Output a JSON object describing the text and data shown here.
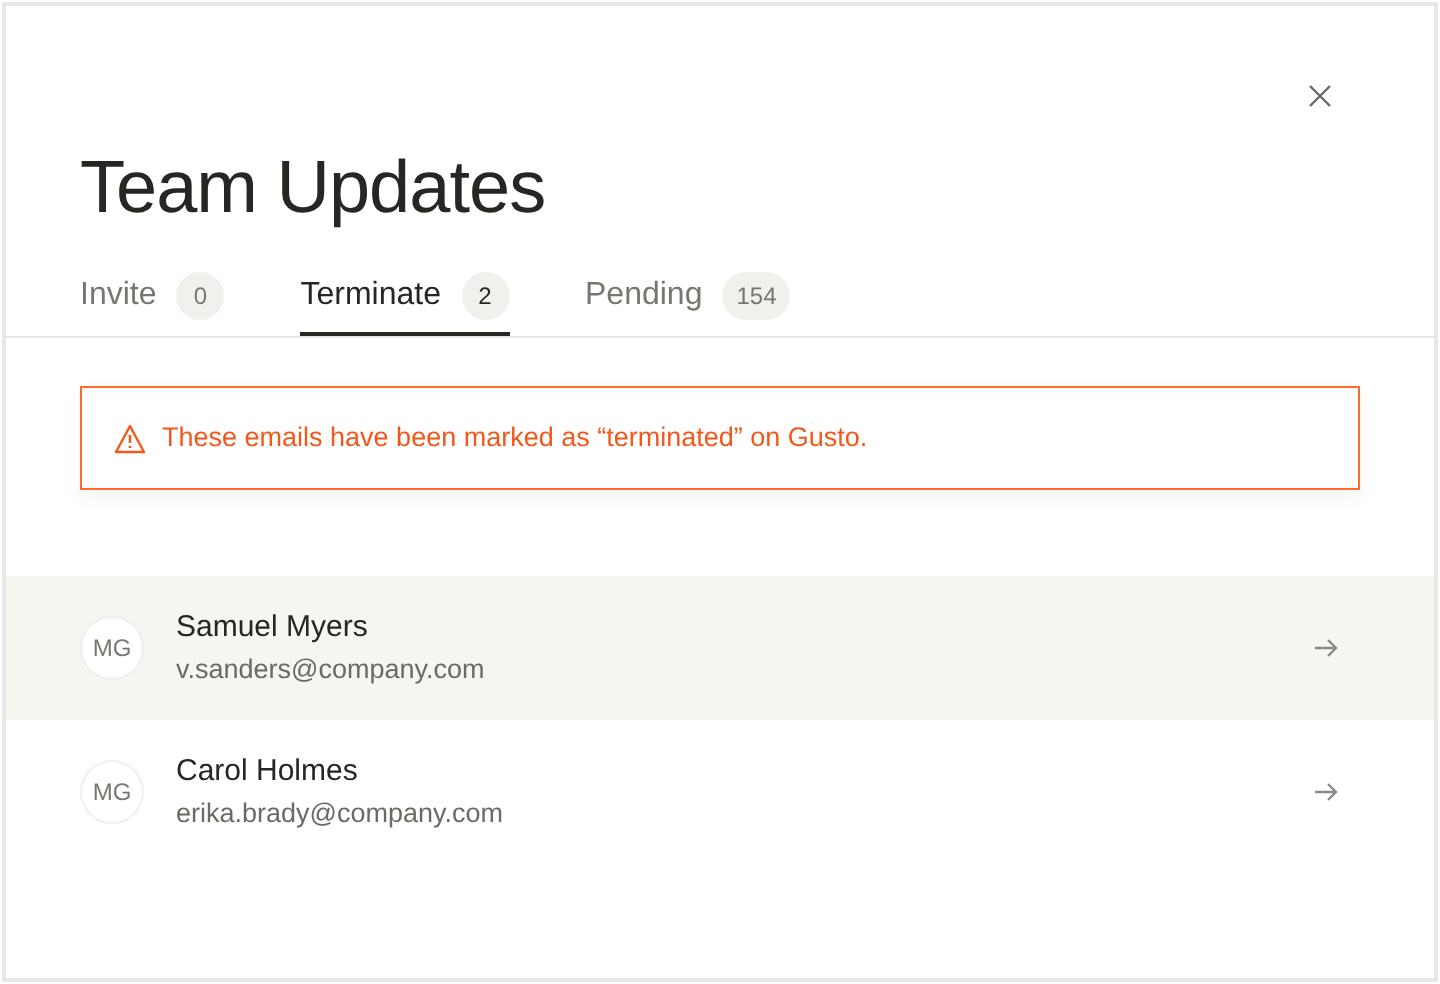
{
  "dialog": {
    "title": "Team Updates"
  },
  "tabs": [
    {
      "label": "Invite",
      "count": "0",
      "selected": false
    },
    {
      "label": "Terminate",
      "count": "2",
      "selected": true
    },
    {
      "label": "Pending",
      "count": "154",
      "selected": false
    }
  ],
  "alert": {
    "message": "These emails have been marked as “terminated” on Gusto."
  },
  "people": [
    {
      "initials": "MG",
      "name": "Samuel Myers",
      "email": "v.sanders@company.com",
      "selected": true
    },
    {
      "initials": "MG",
      "name": "Carol Holmes",
      "email": "erika.brady@company.com",
      "selected": false
    }
  ]
}
